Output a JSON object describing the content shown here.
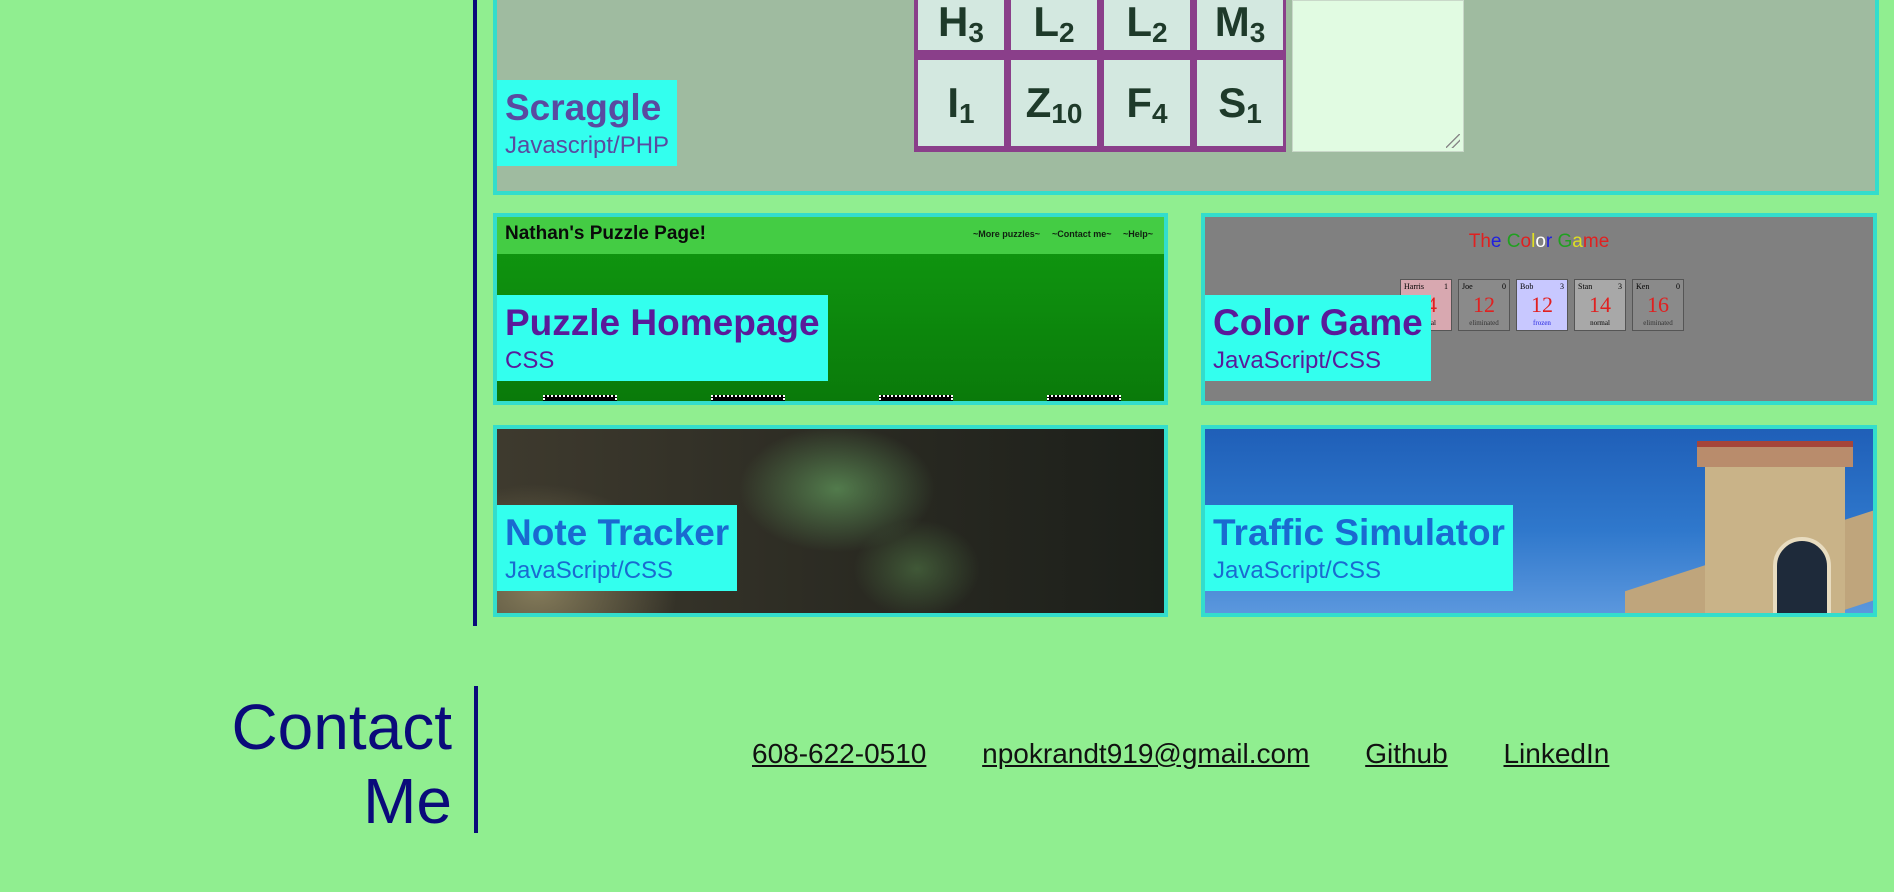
{
  "colors": {
    "background": "#90EE90",
    "accent_line": "#0a0a7a",
    "label_bg": "#33ffee",
    "card_border": "#33ddcc"
  },
  "projects": [
    {
      "id": "scraggle",
      "title": "Scraggle",
      "tech": "Javascript/PHP",
      "title_color": "#5a4aa0",
      "tiles": [
        {
          "letter": "H",
          "points": "3"
        },
        {
          "letter": "L",
          "points": "2"
        },
        {
          "letter": "L",
          "points": "2"
        },
        {
          "letter": "M",
          "points": "3"
        },
        {
          "letter": "I",
          "points": "1"
        },
        {
          "letter": "Z",
          "points": "10"
        },
        {
          "letter": "F",
          "points": "4"
        },
        {
          "letter": "S",
          "points": "1"
        }
      ]
    },
    {
      "id": "puzzle-homepage",
      "title": "Puzzle Homepage",
      "tech": "CSS",
      "title_color": "#5a1a9a",
      "preview_title": "Nathan's Puzzle Page!",
      "preview_nav": [
        "~More puzzles~",
        "~Contact me~",
        "~Help~"
      ]
    },
    {
      "id": "color-game",
      "title": "Color Game",
      "tech": "JavaScript/CSS",
      "title_color": "#5a1a9a",
      "preview_title_letters": [
        {
          "ch": "T",
          "color": "#e02020"
        },
        {
          "ch": "h",
          "color": "#e02020"
        },
        {
          "ch": "e",
          "color": "#2020e0"
        },
        {
          "ch": " ",
          "color": "#000000"
        },
        {
          "ch": "C",
          "color": "#20a020"
        },
        {
          "ch": "o",
          "color": "#e02020"
        },
        {
          "ch": "l",
          "color": "#e0e020"
        },
        {
          "ch": "o",
          "color": "#ffffff"
        },
        {
          "ch": "r",
          "color": "#2020e0"
        },
        {
          "ch": " ",
          "color": "#000000"
        },
        {
          "ch": "G",
          "color": "#20a020"
        },
        {
          "ch": "a",
          "color": "#e0e020"
        },
        {
          "ch": "m",
          "color": "#e02020"
        },
        {
          "ch": "e",
          "color": "#e02020"
        }
      ],
      "players": [
        {
          "name": "Harris",
          "score": "1",
          "value": "14",
          "status": "normal",
          "bg": "#d8a8b0",
          "status_color": "#000000"
        },
        {
          "name": "Joe",
          "score": "0",
          "value": "12",
          "status": "eliminated",
          "bg": "#8a8a8a",
          "status_color": "#333333"
        },
        {
          "name": "Bob",
          "score": "3",
          "value": "12",
          "status": "frozen",
          "bg": "#c8c8ff",
          "status_color": "#2020e0"
        },
        {
          "name": "Stan",
          "score": "3",
          "value": "14",
          "status": "normal",
          "bg": "#a8a8a8",
          "status_color": "#000000"
        },
        {
          "name": "Ken",
          "score": "0",
          "value": "16",
          "status": "eliminated",
          "bg": "#8a8a8a",
          "status_color": "#333333"
        }
      ]
    },
    {
      "id": "note-tracker",
      "title": "Note Tracker",
      "tech": "JavaScript/CSS",
      "title_color": "#1a6ad0"
    },
    {
      "id": "traffic-simulator",
      "title": "Traffic Simulator",
      "tech": "JavaScript/CSS",
      "title_color": "#1a6ad0"
    }
  ],
  "contact": {
    "heading_line1": "Contact",
    "heading_line2": "Me",
    "phone": "608-622-0510",
    "email": "npokrandt919@gmail.com",
    "github": "Github",
    "linkedin": "LinkedIn"
  }
}
